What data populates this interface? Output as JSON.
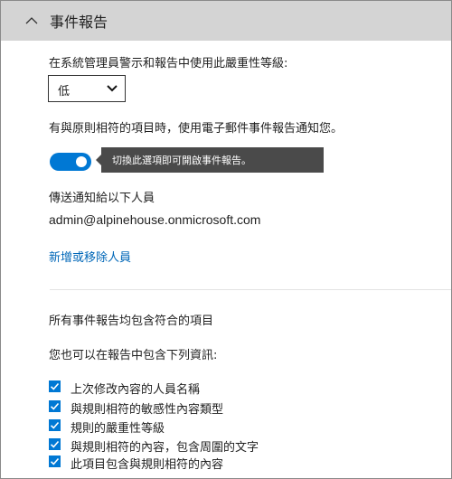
{
  "section": {
    "title": "事件報告"
  },
  "severity": {
    "label": "在系統管理員警示和報告中使用此嚴重性等級:",
    "selected": "低"
  },
  "notify": {
    "label": "有與原則相符的項目時，使用電子郵件事件報告通知您。",
    "toggle_on": true,
    "tooltip": "切換此選項即可開啟事件報告。"
  },
  "recipients": {
    "label": "傳送通知給以下人員",
    "email": "admin@alpinehouse.onmicrosoft.com",
    "edit_link": "新增或移除人員"
  },
  "report": {
    "included_text": "所有事件報告均包含符合的項目",
    "also_text": "您也可以在報告中包含下列資訊:",
    "options": [
      {
        "label": "上次修改內容的人員名稱",
        "checked": true
      },
      {
        "label": "與規則相符的敏感性內容類型",
        "checked": true
      },
      {
        "label": "規則的嚴重性等級",
        "checked": true
      },
      {
        "label": "與規則相符的內容，包含周圍的文字",
        "checked": true
      },
      {
        "label": "此項目包含與規則相符的內容",
        "checked": true
      }
    ]
  },
  "colors": {
    "header_bg": "#d4d4d4",
    "accent": "#0078d4",
    "link": "#0067b8",
    "tooltip_bg": "#4a4a4a"
  }
}
